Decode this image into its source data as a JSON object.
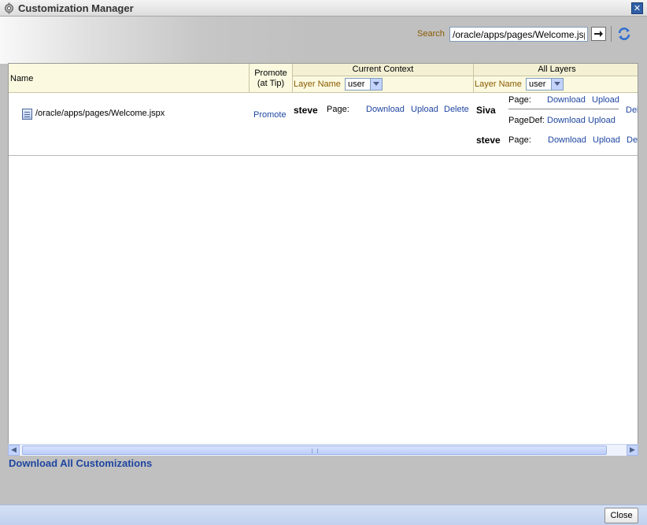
{
  "window": {
    "title": "Customization Manager"
  },
  "search": {
    "label": "Search",
    "value": "/oracle/apps/pages/Welcome.jspx"
  },
  "table": {
    "headers": {
      "name": "Name",
      "promote_line1": "Promote",
      "promote_line2": "(at Tip)",
      "current_context": "Current Context",
      "all_layers": "All Layers",
      "layer_name_label": "Layer Name",
      "current_context_layer": "user",
      "all_layers_layer": "user"
    },
    "row": {
      "file": "/oracle/apps/pages/Welcome.jspx",
      "promote": "Promote",
      "current_context": {
        "user": "steve",
        "type": "Page:",
        "download": "Download",
        "upload": "Upload",
        "delete": "Delete"
      },
      "all_layers": [
        {
          "user": "Siva",
          "type": "Page:",
          "download": "Download",
          "upload": "Upload",
          "delete": "Del"
        },
        {
          "user": "",
          "type": "PageDef:",
          "download": "Download",
          "upload": "Upload",
          "delete": ""
        },
        {
          "user": "steve",
          "type": "Page:",
          "download": "Download",
          "upload": "Upload",
          "delete": "Del"
        }
      ]
    }
  },
  "footer": {
    "download_all": "Download All Customizations",
    "close": "Close"
  }
}
